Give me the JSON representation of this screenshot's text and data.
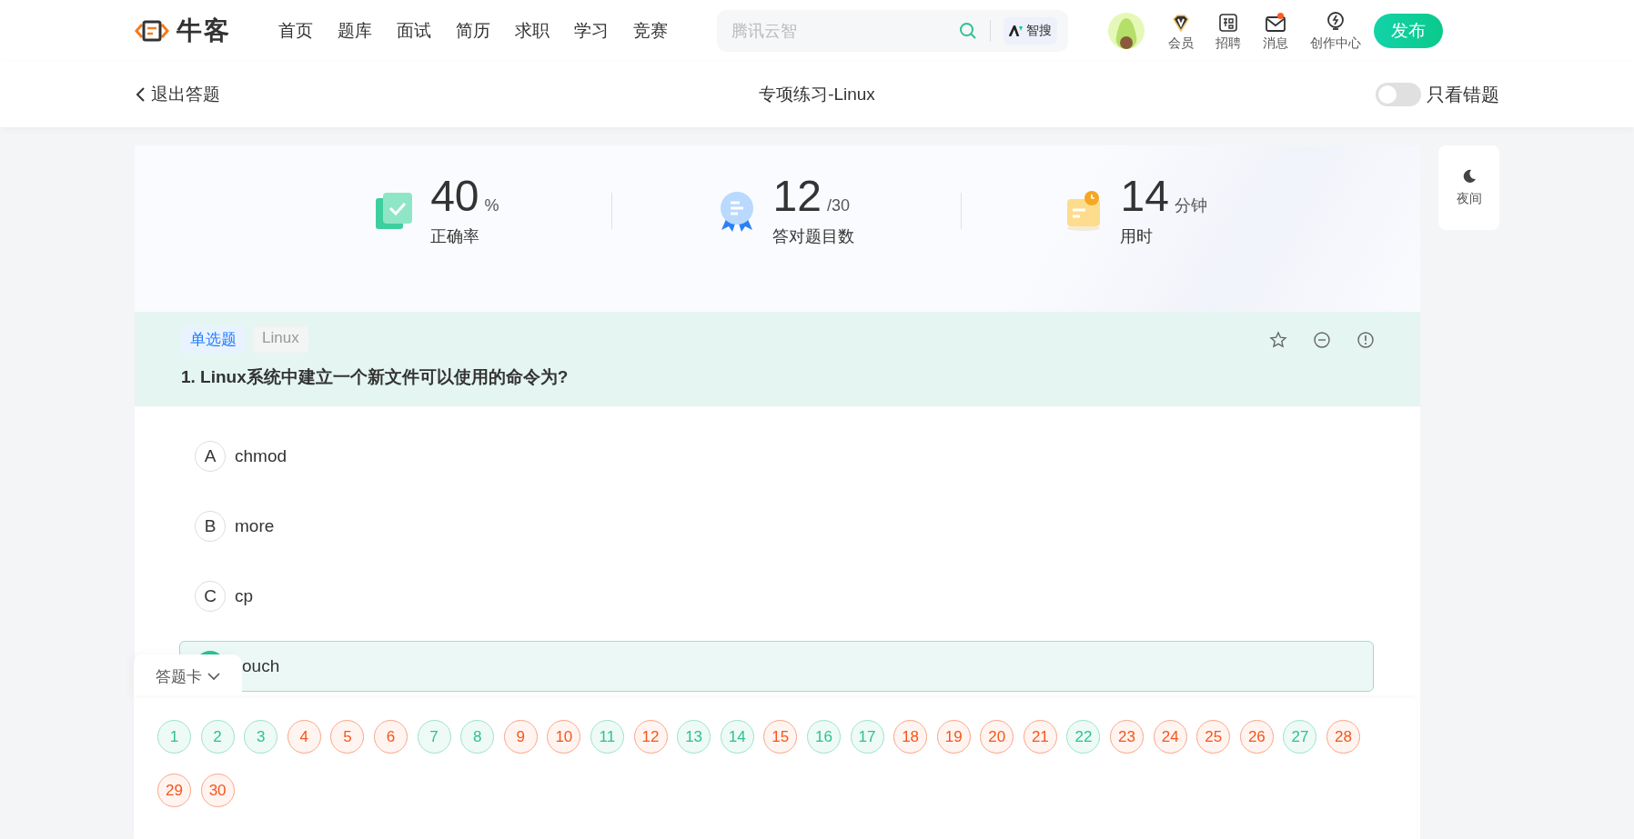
{
  "header": {
    "logo": "牛客",
    "nav": [
      "首页",
      "题库",
      "面试",
      "简历",
      "求职",
      "学习",
      "竞赛"
    ],
    "search": {
      "placeholder": "腾讯云智",
      "ai_label": "智搜"
    },
    "tools": [
      {
        "kind": "vip",
        "label": "会员",
        "unread": false
      },
      {
        "kind": "jobs",
        "label": "招聘",
        "unread": false
      },
      {
        "kind": "mail",
        "label": "消息",
        "unread": true
      },
      {
        "kind": "create",
        "label": "创作中心",
        "unread": false
      }
    ],
    "publish": "发布"
  },
  "subheader": {
    "back": "退出答题",
    "title": "专项练习-Linux",
    "only_wrong": {
      "label": "只看错题",
      "on": false
    }
  },
  "stats": [
    {
      "kind": "accuracy",
      "value": "40",
      "unit": "%",
      "label": "正确率"
    },
    {
      "kind": "correct",
      "value": "12",
      "unit": "/30",
      "label": "答对题目数"
    },
    {
      "kind": "time",
      "value": "14",
      "unit": "分钟",
      "label": "用时"
    }
  ],
  "night": "夜间",
  "question": {
    "tags": [
      {
        "kind": "type",
        "label": "单选题"
      },
      {
        "kind": "topic",
        "label": "Linux"
      }
    ],
    "text": "1. Linux系统中建立一个新文件可以使用的命令为?",
    "options": [
      {
        "letter": "A",
        "text": "chmod",
        "selected": false
      },
      {
        "letter": "B",
        "text": "more",
        "selected": false
      },
      {
        "letter": "C",
        "text": "cp",
        "selected": false
      },
      {
        "text": "ouch",
        "selected": true
      }
    ]
  },
  "answer_card": {
    "label": "答题卡",
    "items": [
      {
        "number": "1",
        "correct": true
      },
      {
        "number": "2",
        "correct": true
      },
      {
        "number": "3",
        "correct": true
      },
      {
        "number": "4",
        "correct": false
      },
      {
        "number": "5",
        "correct": false
      },
      {
        "number": "6",
        "correct": false
      },
      {
        "number": "7",
        "correct": true
      },
      {
        "number": "8",
        "correct": true
      },
      {
        "number": "9",
        "correct": false
      },
      {
        "number": "10",
        "correct": false
      },
      {
        "number": "11",
        "correct": true
      },
      {
        "number": "12",
        "correct": false
      },
      {
        "number": "13",
        "correct": true
      },
      {
        "number": "14",
        "correct": true
      },
      {
        "number": "15",
        "correct": false
      },
      {
        "number": "16",
        "correct": true
      },
      {
        "number": "17",
        "correct": true
      },
      {
        "number": "18",
        "correct": false
      },
      {
        "number": "19",
        "correct": false
      },
      {
        "number": "20",
        "correct": false
      },
      {
        "number": "21",
        "correct": false
      },
      {
        "number": "22",
        "correct": true
      },
      {
        "number": "23",
        "correct": false
      },
      {
        "number": "24",
        "correct": false
      },
      {
        "number": "25",
        "correct": false
      },
      {
        "number": "26",
        "correct": false
      },
      {
        "number": "27",
        "correct": true
      },
      {
        "number": "28",
        "correct": false
      },
      {
        "number": "29",
        "correct": false
      },
      {
        "number": "30",
        "correct": false
      }
    ]
  }
}
